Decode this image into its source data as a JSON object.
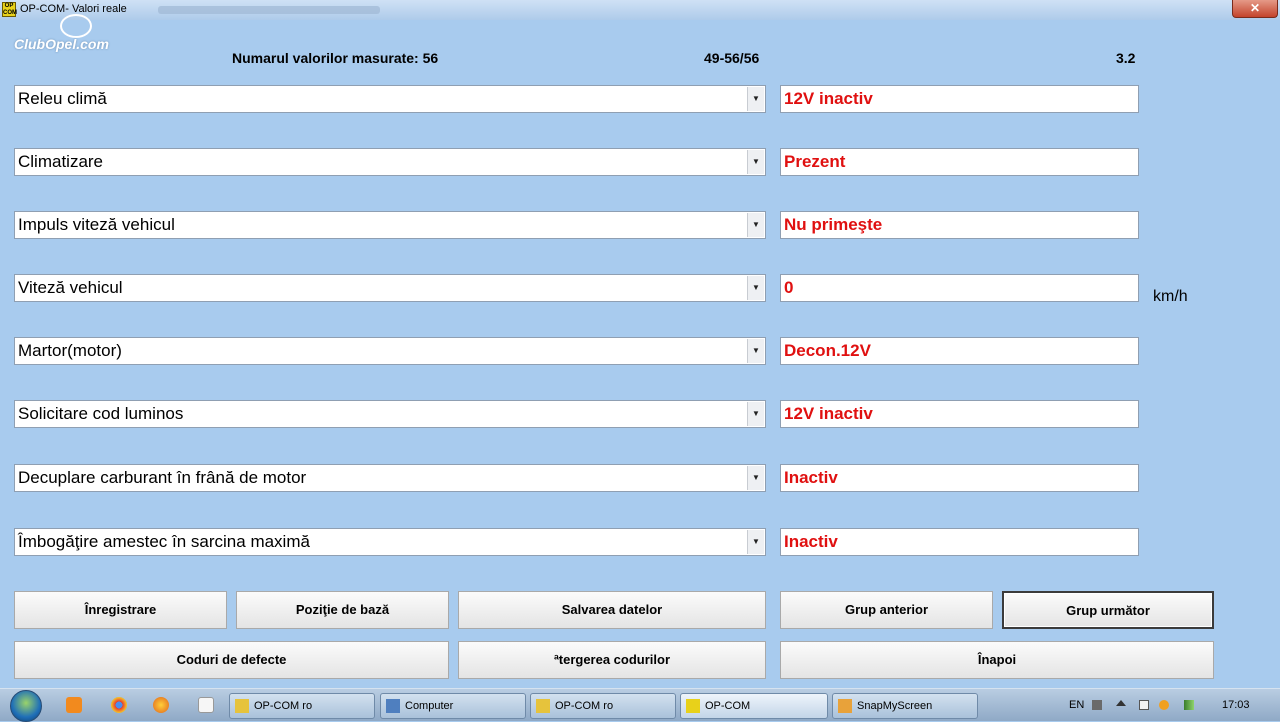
{
  "window": {
    "title": "OP-COM- Valori reale",
    "app_icon_text": "OP COM",
    "close_glyph": "✕"
  },
  "branding": {
    "logo_text": "ClubOpel.com"
  },
  "header": {
    "count_label": "Numarul valorilor masurate: 56",
    "range": "49-56/56",
    "version": "3.2"
  },
  "rows": [
    {
      "name": "Releu climă",
      "value": "12V inactiv",
      "unit": ""
    },
    {
      "name": "Climatizare",
      "value": "Prezent",
      "unit": ""
    },
    {
      "name": "Impuls viteză vehicul",
      "value": "Nu primeşte",
      "unit": ""
    },
    {
      "name": "Viteză vehicul",
      "value": "0",
      "unit": "km/h"
    },
    {
      "name": "Martor(motor)",
      "value": "Decon.12V",
      "unit": ""
    },
    {
      "name": "Solicitare cod luminos",
      "value": "12V inactiv",
      "unit": ""
    },
    {
      "name": "Decuplare carburant în frână de motor",
      "value": "Inactiv",
      "unit": ""
    },
    {
      "name": "Îmbogăţire amestec în sarcina maximă",
      "value": "Inactiv",
      "unit": ""
    }
  ],
  "dropdown_arrow": "▼",
  "buttons": {
    "record": "Înregistrare",
    "base_position": "Poziţie de bază",
    "save_data": "Salvarea datelor",
    "prev_group": "Grup anterior",
    "next_group": "Grup următor",
    "fault_codes": "Coduri de defecte",
    "clear_codes": "ªtergerea codurilor",
    "back": "Înapoi"
  },
  "taskbar": {
    "items": [
      "OP-COM ro",
      "Computer",
      "OP-COM ro",
      "OP-COM",
      "SnapMyScreen"
    ],
    "language": "EN",
    "clock": "17:03"
  },
  "colors": {
    "background": "#a8cbee",
    "value_text": "#e01010"
  }
}
